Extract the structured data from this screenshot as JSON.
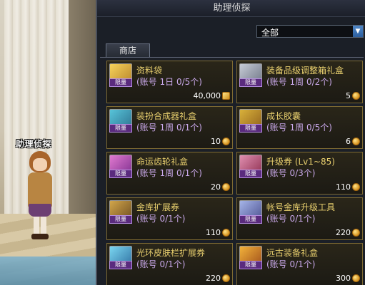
{
  "window": {
    "title": "助理侦探"
  },
  "npc": {
    "name": "助理侦探"
  },
  "filter": {
    "selected": "全部"
  },
  "tabs": [
    {
      "label": "商店"
    }
  ],
  "limit_badge": "限量",
  "items": [
    {
      "name": "资料袋",
      "desc": "(账号 1日 0/5个)",
      "price": "40,000",
      "currency": "gold",
      "icon": "document-bag-icon"
    },
    {
      "name": "装备品级调整箱礼盒",
      "desc": "(账号 1周 0/2个)",
      "price": "5",
      "currency": "coin",
      "icon": "equipment-box-icon"
    },
    {
      "name": "装扮合成器礼盒",
      "desc": "(账号 1周 0/1个)",
      "price": "10",
      "currency": "coin",
      "icon": "synthesizer-box-icon"
    },
    {
      "name": "成长胶囊",
      "desc": "(账号 1周 0/5个)",
      "price": "6",
      "currency": "coin",
      "icon": "growth-capsule-icon"
    },
    {
      "name": "命运齿轮礼盒",
      "desc": "(账号 1周 0/1个)",
      "price": "20",
      "currency": "coin",
      "icon": "gear-gift-icon"
    },
    {
      "name": "升级券 (Lv1~85)",
      "desc": "(账号 0/3个)",
      "price": "110",
      "currency": "coin",
      "icon": "level-ticket-icon"
    },
    {
      "name": "金库扩展券",
      "desc": "(账号 0/1个)",
      "price": "110",
      "currency": "coin",
      "icon": "vault-chest-icon"
    },
    {
      "name": "帐号金库升级工具",
      "desc": "(账号 0/1个)",
      "price": "220",
      "currency": "coin",
      "icon": "vault-tool-icon"
    },
    {
      "name": "光环皮肤栏扩展券",
      "desc": "(账号 0/1个)",
      "price": "220",
      "currency": "coin",
      "icon": "aura-skin-icon"
    },
    {
      "name": "远古装备礼盒",
      "desc": "(账号 0/1个)",
      "price": "300",
      "currency": "coin",
      "icon": "ancient-gear-box-icon"
    }
  ]
}
